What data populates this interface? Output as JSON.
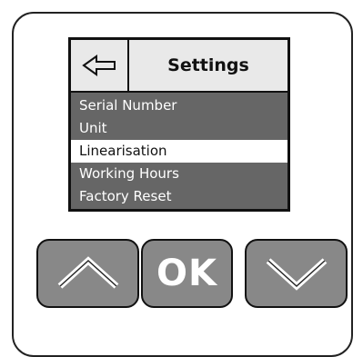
{
  "header": {
    "title": "Settings",
    "back_icon": "back-arrow-icon"
  },
  "menu": {
    "items": [
      {
        "label": "Serial Number",
        "selected": false
      },
      {
        "label": "Unit",
        "selected": false
      },
      {
        "label": "Linearisation",
        "selected": true
      },
      {
        "label": "Working Hours",
        "selected": false
      },
      {
        "label": "Factory Reset",
        "selected": false
      }
    ]
  },
  "buttons": {
    "up_icon": "chevron-up-icon",
    "ok_label": "OK",
    "down_icon": "chevron-down-icon"
  },
  "colors": {
    "screen_background": "#666666",
    "header_background": "#e9e9e9",
    "selected_background": "#ffffff",
    "button_face": "#888888",
    "outline": "#111111"
  }
}
